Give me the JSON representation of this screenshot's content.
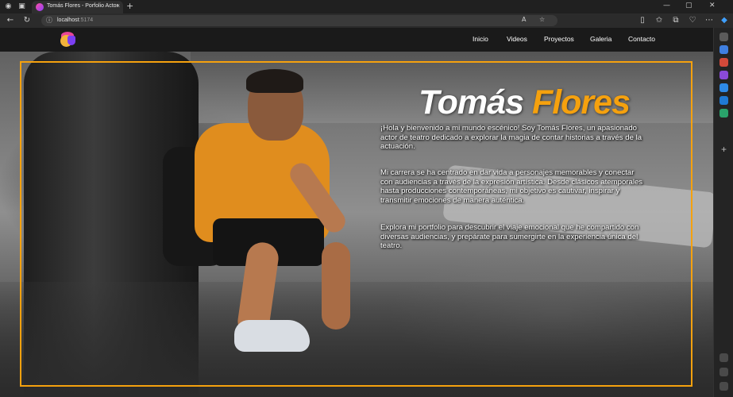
{
  "browser": {
    "tab_title": "Tomás Flores - Porfolio Actor",
    "tab_close": "×",
    "new_tab": "+",
    "url_host": "localhost",
    "url_port": ":5174",
    "icons": [
      "back-icon",
      "refresh-icon",
      "info-icon",
      "read-aloud-icon",
      "favorite-icon",
      "split-screen-icon",
      "favorites-icon",
      "collections-icon",
      "extensions-icon",
      "more-icon",
      "copilot-icon"
    ],
    "window_controls": [
      "—",
      "▢",
      "✕"
    ]
  },
  "site": {
    "menu": [
      "Inicio",
      "Videos",
      "Proyectos",
      "Galeria",
      "Contacto"
    ],
    "hero": {
      "first_name": "Tomás",
      "last_name": "Flores",
      "paragraphs": [
        "¡Hola y bienvenido a mi mundo escénico! Soy Tomás Flores, un apasionado actor de teatro dedicado a explorar la magia de contar historias a través de la actuación.",
        "Mi carrera se ha centrado en dar vida a personajes memorables y conectar con audiencias a través de la expresión artística. Desde clásicos atemporales hasta producciones contemporáneas, mi objetivo es cautivar, inspirar y transmitir emociones de manera auténtica.",
        "Explora mi portfolio para descubrir el viaje emocional que he compartido con diversas audiencias, y prepárate para sumergirte en la experiencia única del teatro."
      ]
    }
  },
  "colors": {
    "accent": "#f5a10e",
    "header_bg": "#1a1a1a",
    "text": "#ffffff"
  }
}
